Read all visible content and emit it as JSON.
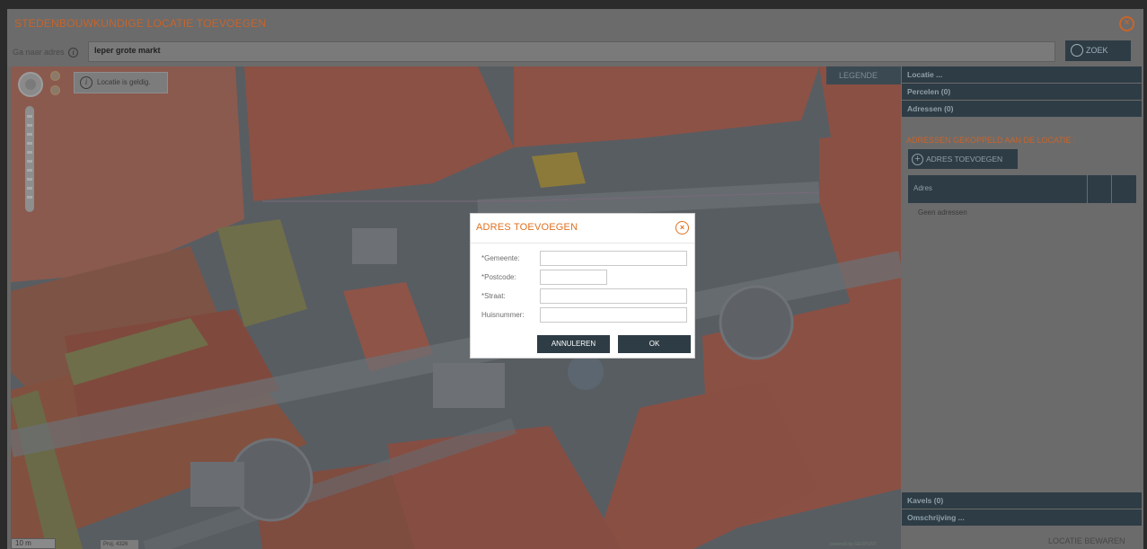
{
  "window": {
    "title": "STEDENBOUWKUNDIGE LOCATIE TOEVOEGEN",
    "close_icon": "close-circle-icon"
  },
  "address_bar": {
    "label": "Ga naar adres",
    "info_glyph": "i",
    "value": "Ieper grote markt",
    "search_label": "ZOEK"
  },
  "map": {
    "validity_glyph": "i",
    "validity_message": "Locatie is geldig.",
    "legend_label": "LEGENDE",
    "scale_label": "10 m",
    "projection_label": "Proj. 4326",
    "powered_by": "powered by GEOPUNT"
  },
  "sidebar": {
    "sections_top": [
      {
        "label": "Locatie ..."
      },
      {
        "label": "Percelen (0)"
      },
      {
        "label": "Adressen (0)"
      }
    ],
    "linked_title": "ADRESSEN GEKOPPELD AAN DE LOCATIE :",
    "add_address_label": "ADRES TOEVOEGEN",
    "table_header": {
      "col1": "Adres"
    },
    "empty_text": "Geen adressen",
    "sections_bottom": [
      {
        "label": "Kavels (0)"
      },
      {
        "label": "Omschrijving ..."
      }
    ],
    "save_label": "LOCATIE BEWAREN"
  },
  "modal": {
    "title": "ADRES TOEVOEGEN",
    "fields": [
      {
        "label": "*Gemeente:",
        "value": ""
      },
      {
        "label": "*Postcode:",
        "value": ""
      },
      {
        "label": "*Straat:",
        "value": ""
      },
      {
        "label": "Huisnummer:",
        "value": ""
      }
    ],
    "cancel_label": "ANNULEREN",
    "ok_label": "OK"
  },
  "colors": {
    "accent_orange": "#e0701f",
    "dark_button": "#2e3c45",
    "overlay_gray": "#686868"
  }
}
